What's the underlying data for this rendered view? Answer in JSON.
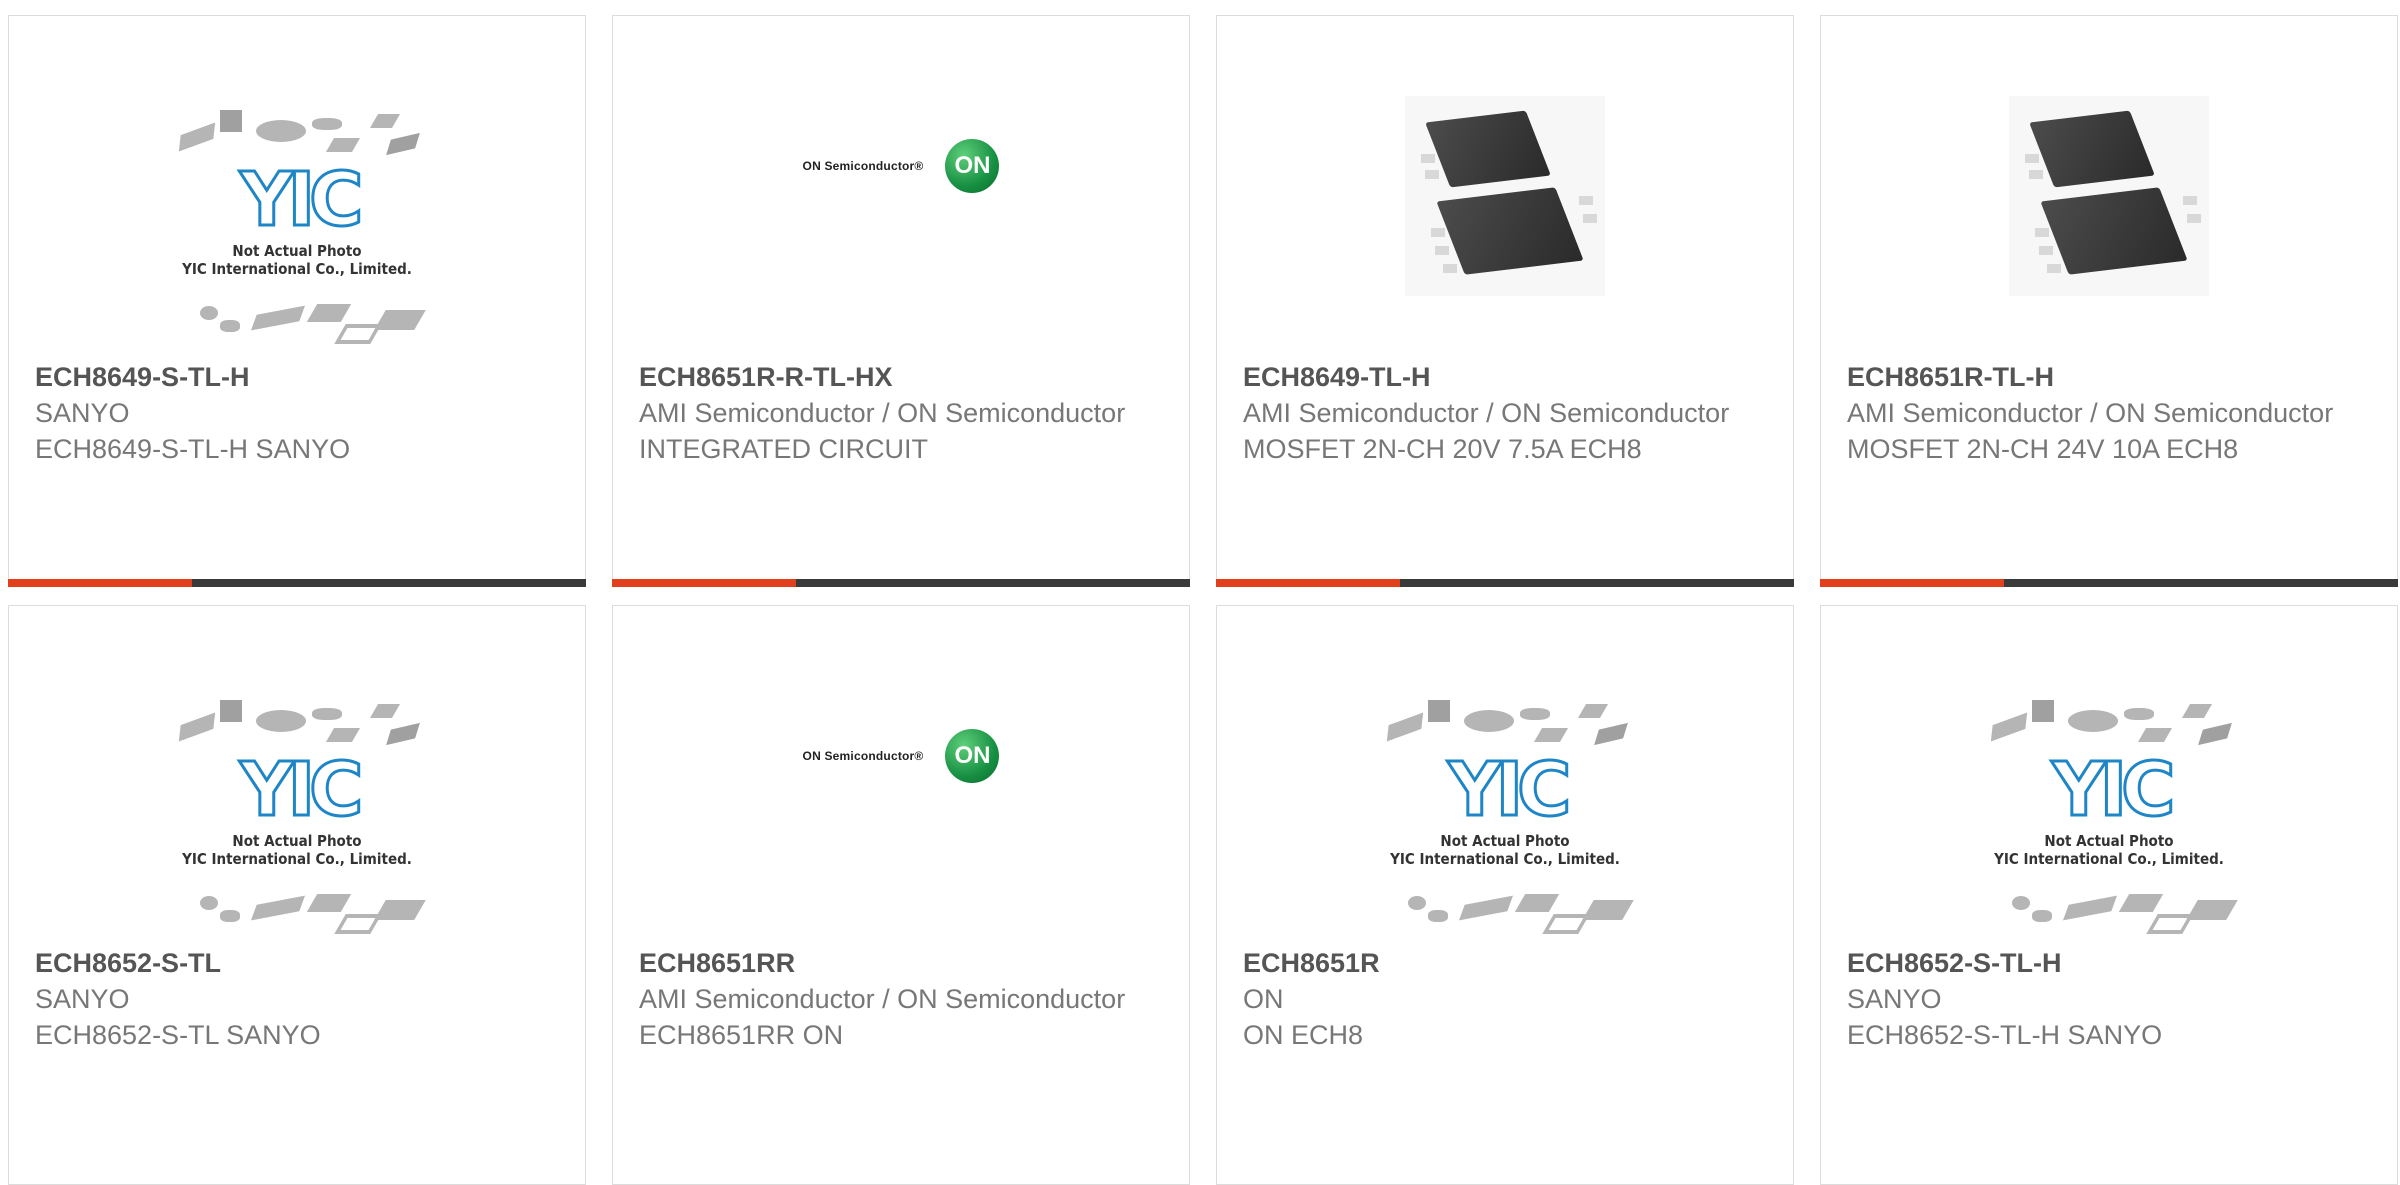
{
  "products": [
    {
      "part": "ECH8649-S-TL-H",
      "manufacturer": "SANYO",
      "description": "ECH8649-S-TL-H SANYO",
      "image": "yic-placeholder",
      "image_note": [
        "Not Actual Photo",
        "YIC International Co., Limited."
      ]
    },
    {
      "part": "ECH8651R-R-TL-HX",
      "manufacturer": "AMI Semiconductor / ON Semiconductor",
      "description": "INTEGRATED CIRCUIT",
      "image": "on-semiconductor-logo",
      "logo_text": "ON Semiconductor®",
      "logo_badge": "ON"
    },
    {
      "part": "ECH8649-TL-H",
      "manufacturer": "AMI Semiconductor / ON Semiconductor",
      "description": "MOSFET 2N-CH 20V 7.5A ECH8",
      "image": "ech8-package-photo"
    },
    {
      "part": "ECH8651R-TL-H",
      "manufacturer": "AMI Semiconductor / ON Semiconductor",
      "description": "MOSFET 2N-CH 24V 10A ECH8",
      "image": "ech8-package-photo"
    },
    {
      "part": "ECH8652-S-TL",
      "manufacturer": "SANYO",
      "description": "ECH8652-S-TL SANYO",
      "image": "yic-placeholder",
      "image_note": [
        "Not Actual Photo",
        "YIC International Co., Limited."
      ]
    },
    {
      "part": "ECH8651RR",
      "manufacturer": "AMI Semiconductor / ON Semiconductor",
      "description": "ECH8651RR ON",
      "image": "on-semiconductor-logo",
      "logo_text": "ON Semiconductor®",
      "logo_badge": "ON"
    },
    {
      "part": "ECH8651R",
      "manufacturer": "ON",
      "description": "ON ECH8",
      "image": "yic-placeholder",
      "image_note": [
        "Not Actual Photo",
        "YIC International Co., Limited."
      ]
    },
    {
      "part": "ECH8652-S-TL-H",
      "manufacturer": "SANYO",
      "description": "ECH8652-S-TL-H SANYO",
      "image": "yic-placeholder",
      "image_note": [
        "Not Actual Photo",
        "YIC International Co., Limited."
      ]
    }
  ],
  "yic_logo_text": "YIC",
  "colors": {
    "accent": "#e2401c",
    "bar": "#3a3a3a",
    "part_text": "#555555",
    "meta_text": "#777777",
    "yic_blue": "#1e86c6",
    "on_green": "#179043"
  }
}
